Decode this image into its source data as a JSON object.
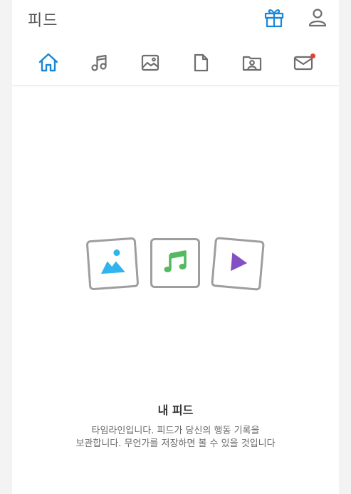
{
  "header": {
    "title": "피드",
    "gift_icon": "gift-icon",
    "profile_icon": "person-icon"
  },
  "tabs": [
    {
      "name": "home",
      "icon": "home-icon",
      "active": true
    },
    {
      "name": "music",
      "icon": "music-note-icon",
      "active": false
    },
    {
      "name": "photo",
      "icon": "image-icon",
      "active": false
    },
    {
      "name": "document",
      "icon": "document-icon",
      "active": false
    },
    {
      "name": "folder",
      "icon": "person-folder-icon",
      "active": false
    },
    {
      "name": "mail",
      "icon": "mail-icon",
      "active": false,
      "has_badge": true
    }
  ],
  "empty_state": {
    "title": "내 피드",
    "description_line1": "타임라인입니다. 피드가 당신의 행동 기록을",
    "description_line2": "보관합니다. 무언가를 저장하면 볼 수 있을 것입니다"
  },
  "colors": {
    "accent": "#1a86d6",
    "icon_gray": "#6e6e6e",
    "photo_blue": "#2fb4ee",
    "music_green": "#56b961",
    "video_purple": "#8350c3",
    "badge_red": "#e6412e"
  }
}
